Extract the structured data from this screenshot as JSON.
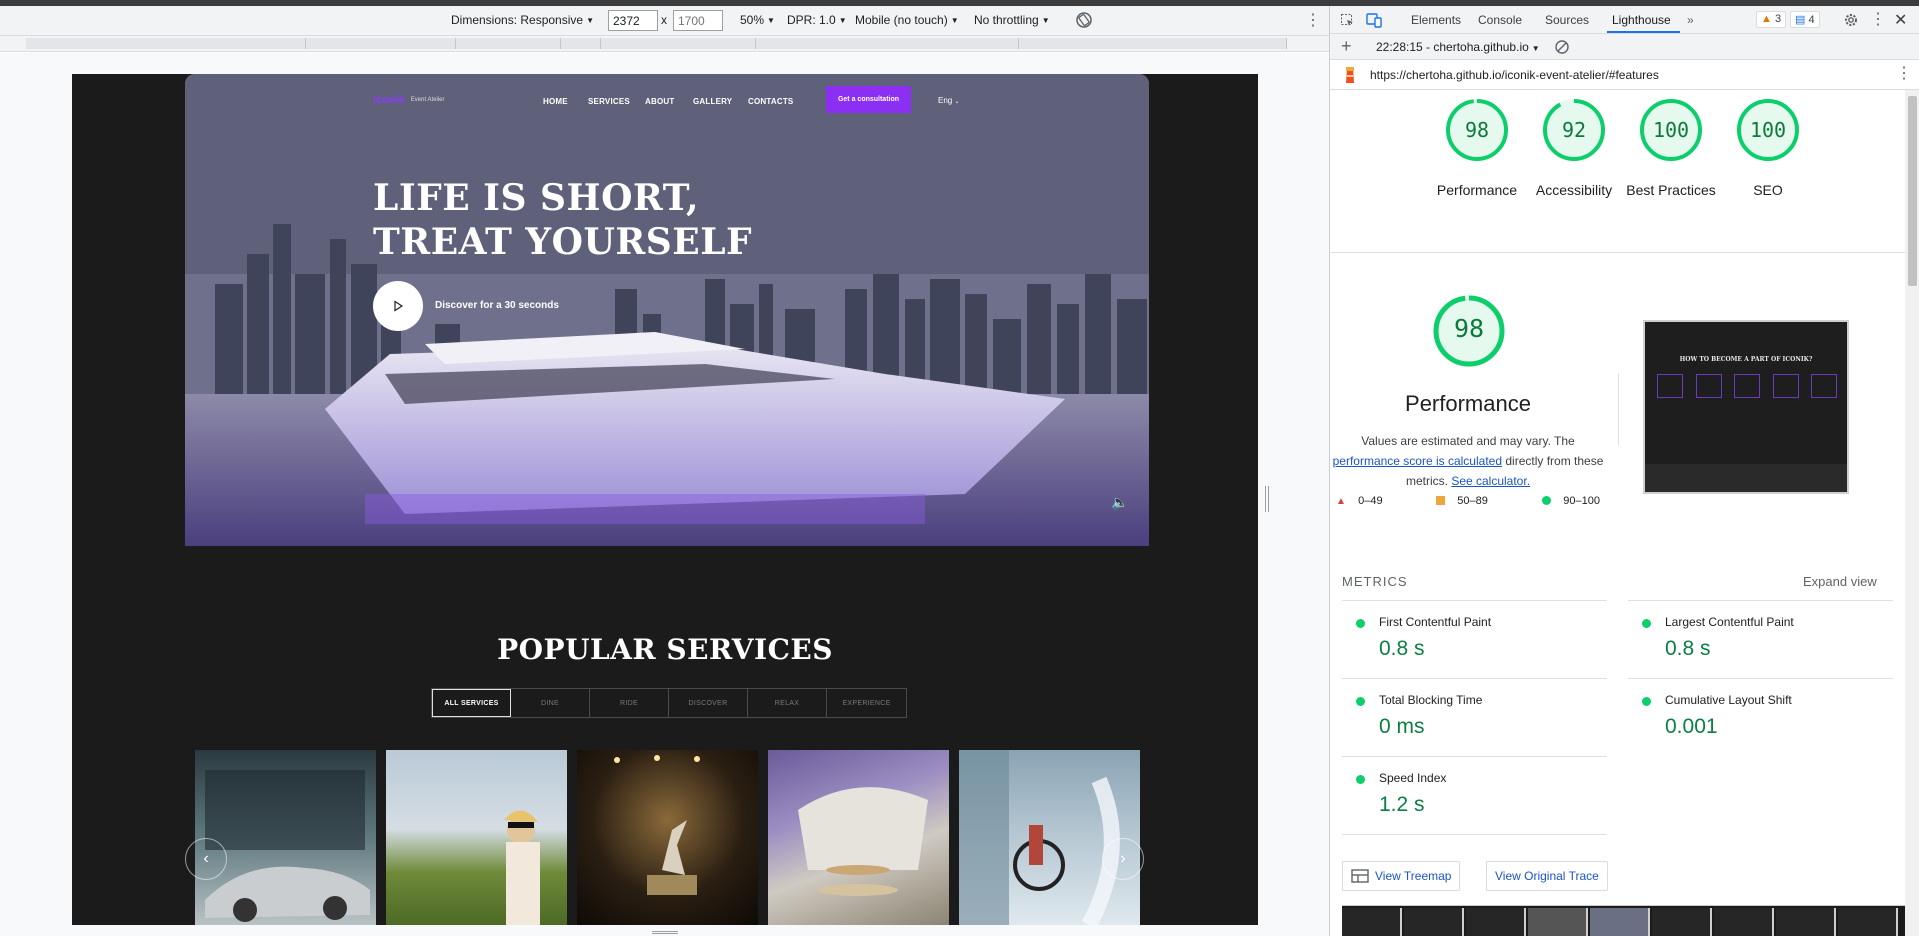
{
  "device_toolbar": {
    "dimensions_label": "Dimensions: Responsive",
    "width_value": "2372",
    "times": "x",
    "height_placeholder": "1700",
    "zoom": "50%",
    "dpr": "DPR: 1.0",
    "device_type": "Mobile (no touch)",
    "throttling": "No throttling"
  },
  "site": {
    "logo": "Iconik",
    "logo_sub": "Event Atelier",
    "nav": [
      "HOME",
      "SERVICES",
      "ABOUT",
      "GALLERY",
      "CONTACTS"
    ],
    "cta": "Get a consultation",
    "lang": "Eng",
    "headline_line1": "LIFE IS SHORT,",
    "headline_line2": "TREAT YOURSELF",
    "discover": "Discover for a 30 seconds",
    "services_title": "POPULAR SERVICES",
    "tabs": [
      "ALL SERVICES",
      "DINE",
      "RIDE",
      "DISCOVER",
      "RELAX",
      "EXPERIENCE"
    ]
  },
  "devtools": {
    "tabs": [
      "Elements",
      "Console",
      "Sources",
      "Lighthouse"
    ],
    "active_tab": "Lighthouse",
    "warnings_count": "3",
    "messages_count": "4",
    "report_time": "22:28:15 - chertoha.github.io",
    "report_url": "https://chertoha.github.io/iconik-event-atelier/#features",
    "scores": [
      {
        "label": "Performance",
        "value": "98",
        "score": 98
      },
      {
        "label": "Accessibility",
        "value": "92",
        "score": 92
      },
      {
        "label": "Best Practices",
        "value": "100",
        "score": 100
      },
      {
        "label": "SEO",
        "value": "100",
        "score": 100
      }
    ],
    "performance": {
      "score": "98",
      "title": "Performance",
      "desc_line1": "Values are estimated and may vary. The",
      "desc_link": "performance score is calculated",
      "desc_mid": "directly from these",
      "desc_line3": "metrics.",
      "desc_link2": "See calculator.",
      "legend": [
        "0–49",
        "50–89",
        "90–100"
      ],
      "screenshot_title": "HOW TO BECOME A PART OF ICONIK?"
    },
    "metrics_header": "METRICS",
    "expand_view": "Expand view",
    "metrics": [
      {
        "name": "First Contentful Paint",
        "value": "0.8 s"
      },
      {
        "name": "Largest Contentful Paint",
        "value": "0.8 s"
      },
      {
        "name": "Total Blocking Time",
        "value": "0 ms"
      },
      {
        "name": "Cumulative Layout Shift",
        "value": "0.001"
      },
      {
        "name": "Speed Index",
        "value": "1.2 s"
      }
    ],
    "view_treemap": "View Treemap",
    "view_trace": "View Original Trace"
  },
  "colors": {
    "accent_purple": "#8b2ff2",
    "score_green": "#0cce6b",
    "link_blue": "#1a55c9"
  }
}
